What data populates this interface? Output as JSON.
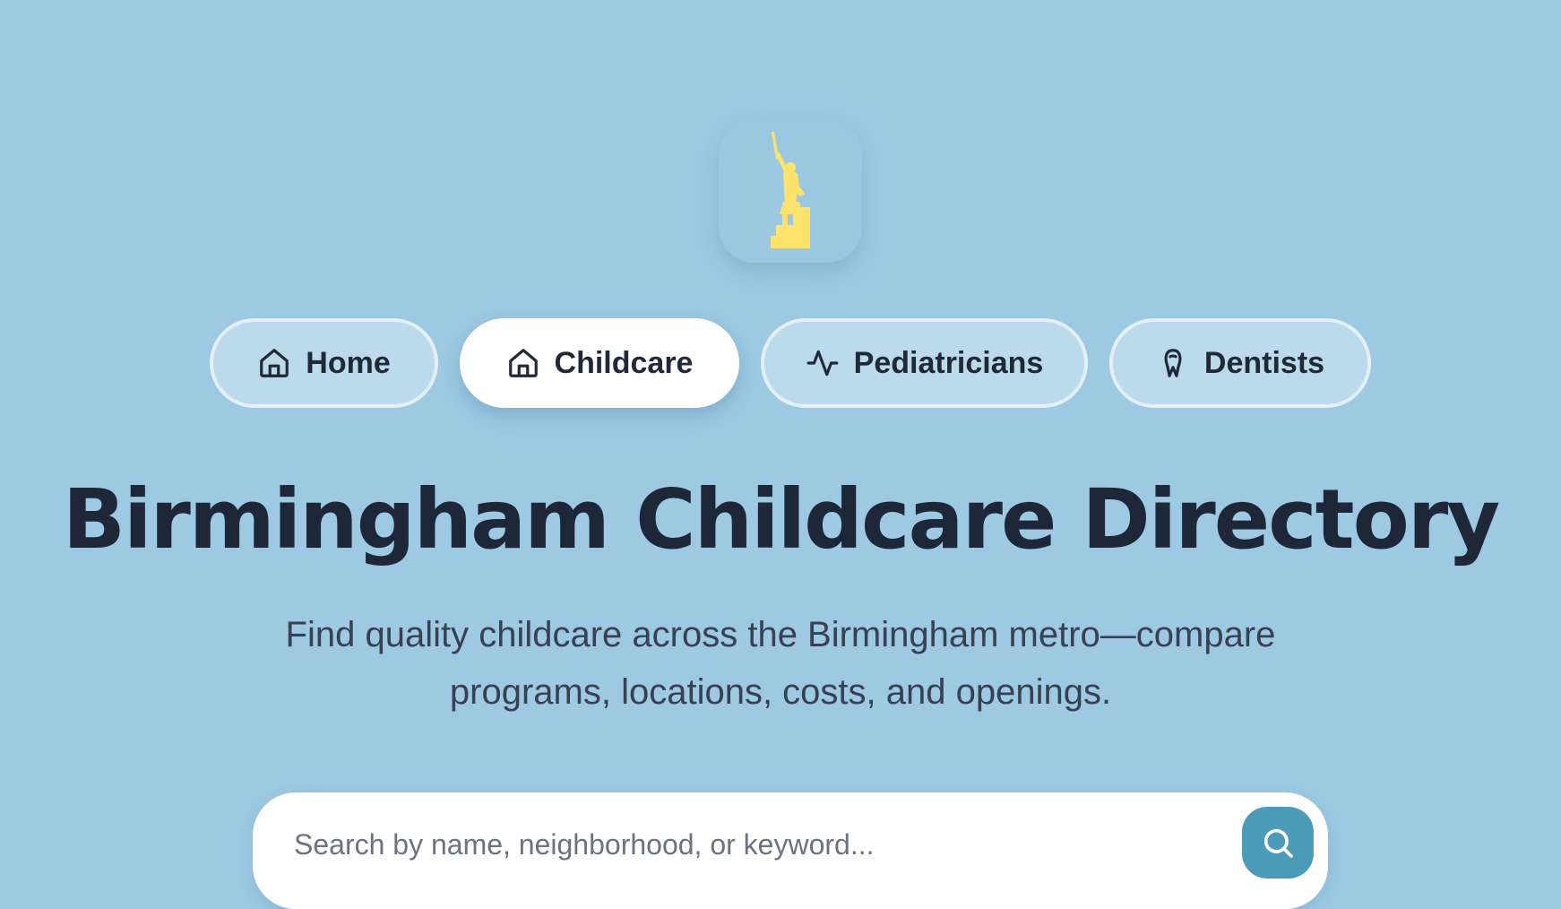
{
  "logo": {
    "icon": "statue-icon",
    "color": "#fde36b"
  },
  "nav": {
    "items": [
      {
        "label": "Home",
        "icon": "home-icon",
        "active": false
      },
      {
        "label": "Childcare",
        "icon": "home-icon",
        "active": true
      },
      {
        "label": "Pediatricians",
        "icon": "heartbeat-icon",
        "active": false
      },
      {
        "label": "Dentists",
        "icon": "tooth-icon",
        "active": false
      }
    ]
  },
  "hero": {
    "title": "Birmingham Childcare Directory",
    "subtitle": "Find quality childcare across the Birmingham metro—compare programs, locations, costs, and openings."
  },
  "search": {
    "placeholder": "Search by name, neighborhood, or keyword...",
    "value": "",
    "button_icon": "search-icon"
  },
  "colors": {
    "background": "#9dc9e3",
    "accent": "#4c9bb9",
    "text": "#1e2738"
  }
}
